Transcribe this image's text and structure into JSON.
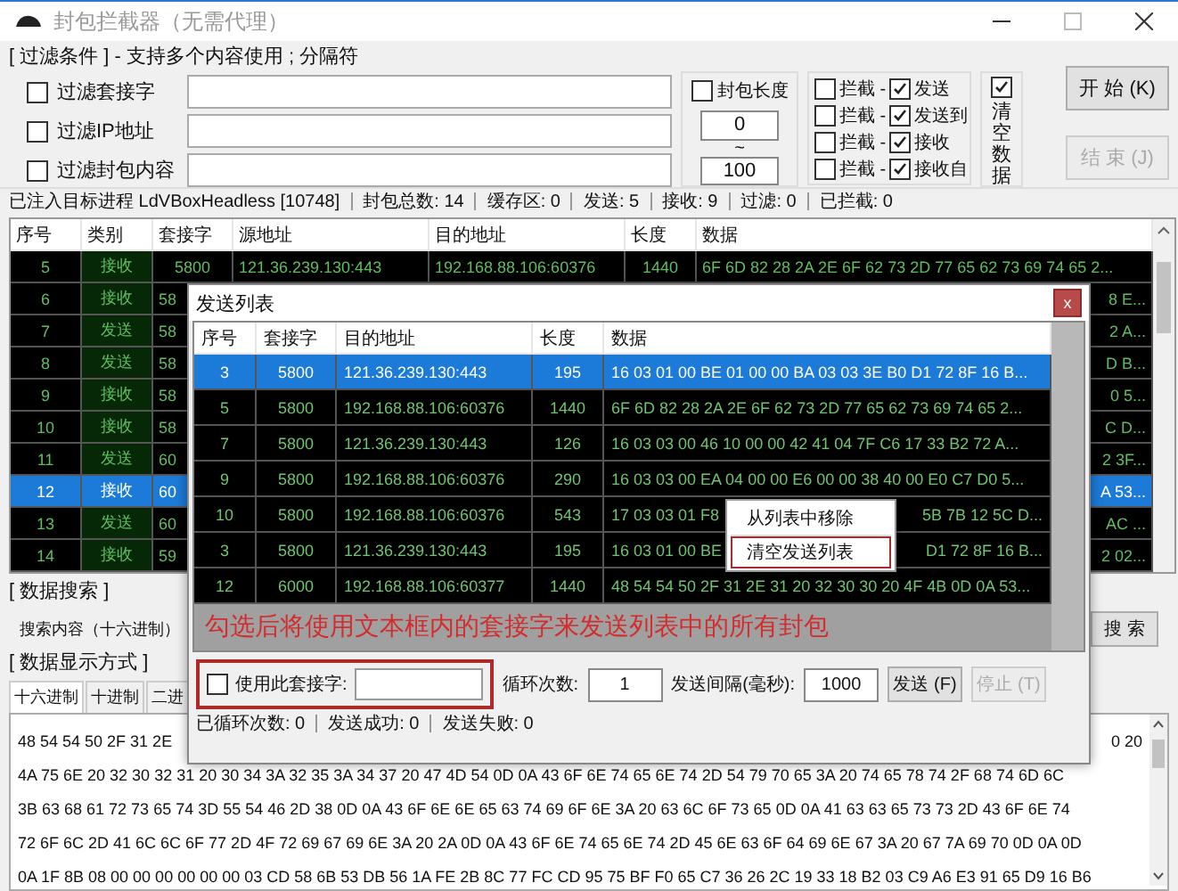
{
  "window": {
    "title": "封包拦截器（无需代理）"
  },
  "filter": {
    "heading": "[ 过滤条件 ] - 支持多个内容使用 ; 分隔符",
    "fields": [
      {
        "label": "过滤套接字",
        "checked": false
      },
      {
        "label": "过滤IP地址",
        "checked": false
      },
      {
        "label": "过滤封包内容",
        "checked": false
      }
    ],
    "length": {
      "label": "封包长度",
      "checked": false,
      "min": "0",
      "separator": "~",
      "max": "100"
    },
    "intercepts": [
      {
        "label": "拦截 -",
        "checked": false,
        "type_label": "发送",
        "type_checked": true
      },
      {
        "label": "拦截 -",
        "checked": false,
        "type_label": "发送到",
        "type_checked": true
      },
      {
        "label": "拦截 -",
        "checked": false,
        "type_label": "接收",
        "type_checked": true
      },
      {
        "label": "拦截 -",
        "checked": false,
        "type_label": "接收自",
        "type_checked": true
      }
    ],
    "clear": {
      "label": "清空数据",
      "checked": true
    },
    "buttons": [
      {
        "label": "开 始 (K)",
        "disabled": false
      },
      {
        "label": "结 束 (J)",
        "disabled": true
      }
    ]
  },
  "status_bar": [
    "已注入目标进程 LdVBoxHeadless [10748]",
    "封包总数: 14",
    "缓存区: 0",
    "发送: 5",
    "接收: 9",
    "过滤: 0",
    "已拦截: 0"
  ],
  "table": {
    "columns": [
      "序号",
      "类别",
      "套接字",
      "源地址",
      "目的地址",
      "长度",
      "数据"
    ],
    "rows": [
      {
        "kind": "full",
        "no": "5",
        "category": "接收",
        "socket": "5800",
        "source": "121.36.239.130:443",
        "destination": "192.168.88.106:60376",
        "length": "1440",
        "data": "6F 6D 82 28 2A 2E 6F 62 73 2D 77 65 62 73 69 74 65 2...",
        "selected": false
      },
      {
        "kind": "covered",
        "no": "6",
        "category": "接收",
        "socket": "58",
        "data": "8 E...",
        "selected": false
      },
      {
        "kind": "covered",
        "no": "7",
        "category": "发送",
        "socket": "58",
        "data": "2 A...",
        "selected": false
      },
      {
        "kind": "covered",
        "no": "8",
        "category": "发送",
        "socket": "58",
        "data": "D B...",
        "selected": false
      },
      {
        "kind": "covered",
        "no": "9",
        "category": "接收",
        "socket": "58",
        "data": "0 5...",
        "selected": false
      },
      {
        "kind": "covered",
        "no": "10",
        "category": "接收",
        "socket": "58",
        "data": "C D...",
        "selected": false
      },
      {
        "kind": "covered",
        "no": "11",
        "category": "发送",
        "socket": "60",
        "data": "2 3F...",
        "selected": false
      },
      {
        "kind": "covered",
        "no": "12",
        "category": "接收",
        "socket": "60",
        "data": "A 53...",
        "selected": true
      },
      {
        "kind": "covered",
        "no": "13",
        "category": "发送",
        "socket": "60",
        "data": "AC ...",
        "selected": false
      },
      {
        "kind": "covered",
        "no": "14",
        "category": "接收",
        "socket": "59",
        "data": "2 02...",
        "selected": false
      }
    ]
  },
  "search": {
    "heading": "[ 数据搜索 ]",
    "label": "搜索内容（十六进制）",
    "button": "搜 索"
  },
  "display": {
    "heading": "[ 数据显示方式 ]",
    "tabs": [
      {
        "label": "十六进制",
        "selected": true
      },
      {
        "label": "十进制",
        "selected": false
      },
      {
        "label": "二进",
        "selected": false
      }
    ],
    "first_line_start": "48 54 54 50 2F 31 2E",
    "first_line_end": "0 20",
    "lines": [
      "4A 75 6E 20 32 30 32 31 20 30 34 3A 32 35 3A 34 37 20 47 4D 54 0D 0A 43 6F 6E 74 65 6E 74 2D 54 79 70 65 3A 20 74 65 78 74 2F 68 74 6D 6C",
      "3B 63 68 61 72 73 65 74 3D 55 54 46 2D 38 0D 0A 43 6F 6E 6E 65 63 74 69 6F 6E 3A 20 63 6C 6F 73 65 0D 0A 41 63 63 65 73 73 2D 43 6F 6E 74",
      "72 6F 6C 2D 41 6C 6C 6F 77 2D 4F 72 69 67 69 6E 3A 20 2A 0D 0A 43 6F 6E 74 65 6E 74 2D 45 6E 63 6F 64 69 6E 67 3A 20 67 7A 69 70 0D 0A 0D",
      "0A 1F 8B 08 00 00 00 00 00 00 03 CD 58 6B 53 DB 56 1A FE 2B 8C 77 FC CD 95 75 BF F0 65 C7 36 26 2C 19 33 18 B2 03 C9 A6 E3 91 65 D9 16 B6"
    ]
  },
  "dialog": {
    "title": "发送列表",
    "close": "x",
    "columns": [
      "序号",
      "套接字",
      "目的地址",
      "长度",
      "数据"
    ],
    "rows": [
      {
        "kind": "plain",
        "no": "3",
        "socket": "5800",
        "destination": "121.36.239.130:443",
        "length": "195",
        "data": "16 03 01 00 BE 01 00 00 BA 03 03 3E B0 D1 72 8F 16 B...",
        "selected": true
      },
      {
        "kind": "plain",
        "no": "5",
        "socket": "5800",
        "destination": "192.168.88.106:60376",
        "length": "1440",
        "data": "6F 6D 82 28 2A 2E 6F 62 73 2D 77 65 62 73 69 74 65 2...",
        "selected": false
      },
      {
        "kind": "plain",
        "no": "7",
        "socket": "5800",
        "destination": "121.36.239.130:443",
        "length": "126",
        "data": "16 03 03 00 46 10 00 00 42 41 04 7F C6 17 33 B2 72 A...",
        "selected": false
      },
      {
        "kind": "plain",
        "no": "9",
        "socket": "5800",
        "destination": "192.168.88.106:60376",
        "length": "290",
        "data": "16 03 03 00 EA 04 00 00 E6 00 00 38 40 00 E0 C7 D0 5...",
        "selected": false
      },
      {
        "kind": "split",
        "no": "10",
        "socket": "5800",
        "destination": "192.168.88.106:60376",
        "length": "543",
        "data_start": "17 03 03 01 F8",
        "data_end": "5B 7B 12 5C D...",
        "selected": false
      },
      {
        "kind": "split",
        "no": "3",
        "socket": "5800",
        "destination": "121.36.239.130:443",
        "length": "195",
        "data_start": "16 03 01 00 BE",
        "data_end": "D1 72 8F 16 B...",
        "selected": false
      },
      {
        "kind": "plain",
        "no": "12",
        "socket": "6000",
        "destination": "192.168.88.106:60377",
        "length": "1440",
        "data": "48 54 54 50 2F 31 2E 31 20 32 30 30 20 4F 4B 0D 0A 53...",
        "selected": false
      }
    ],
    "menu": [
      {
        "label": "从列表中移除",
        "outlined": false
      },
      {
        "label": "清空发送列表",
        "outlined": true
      }
    ],
    "hint": "勾选后将使用文本框内的套接字来发送列表中的所有封包",
    "socket_option": {
      "label": "使用此套接字:",
      "checked": false,
      "outlined": true
    },
    "loop_label": "循环次数:",
    "loop_value": "1",
    "interval_label": "发送间隔(毫秒):",
    "interval_value": "1000",
    "buttons": [
      {
        "label": "发送 (F)",
        "disabled": false
      },
      {
        "label": "停止 (T)",
        "disabled": true
      }
    ],
    "status": [
      "已循环次数: 0",
      "发送成功: 0",
      "发送失败: 0"
    ]
  }
}
